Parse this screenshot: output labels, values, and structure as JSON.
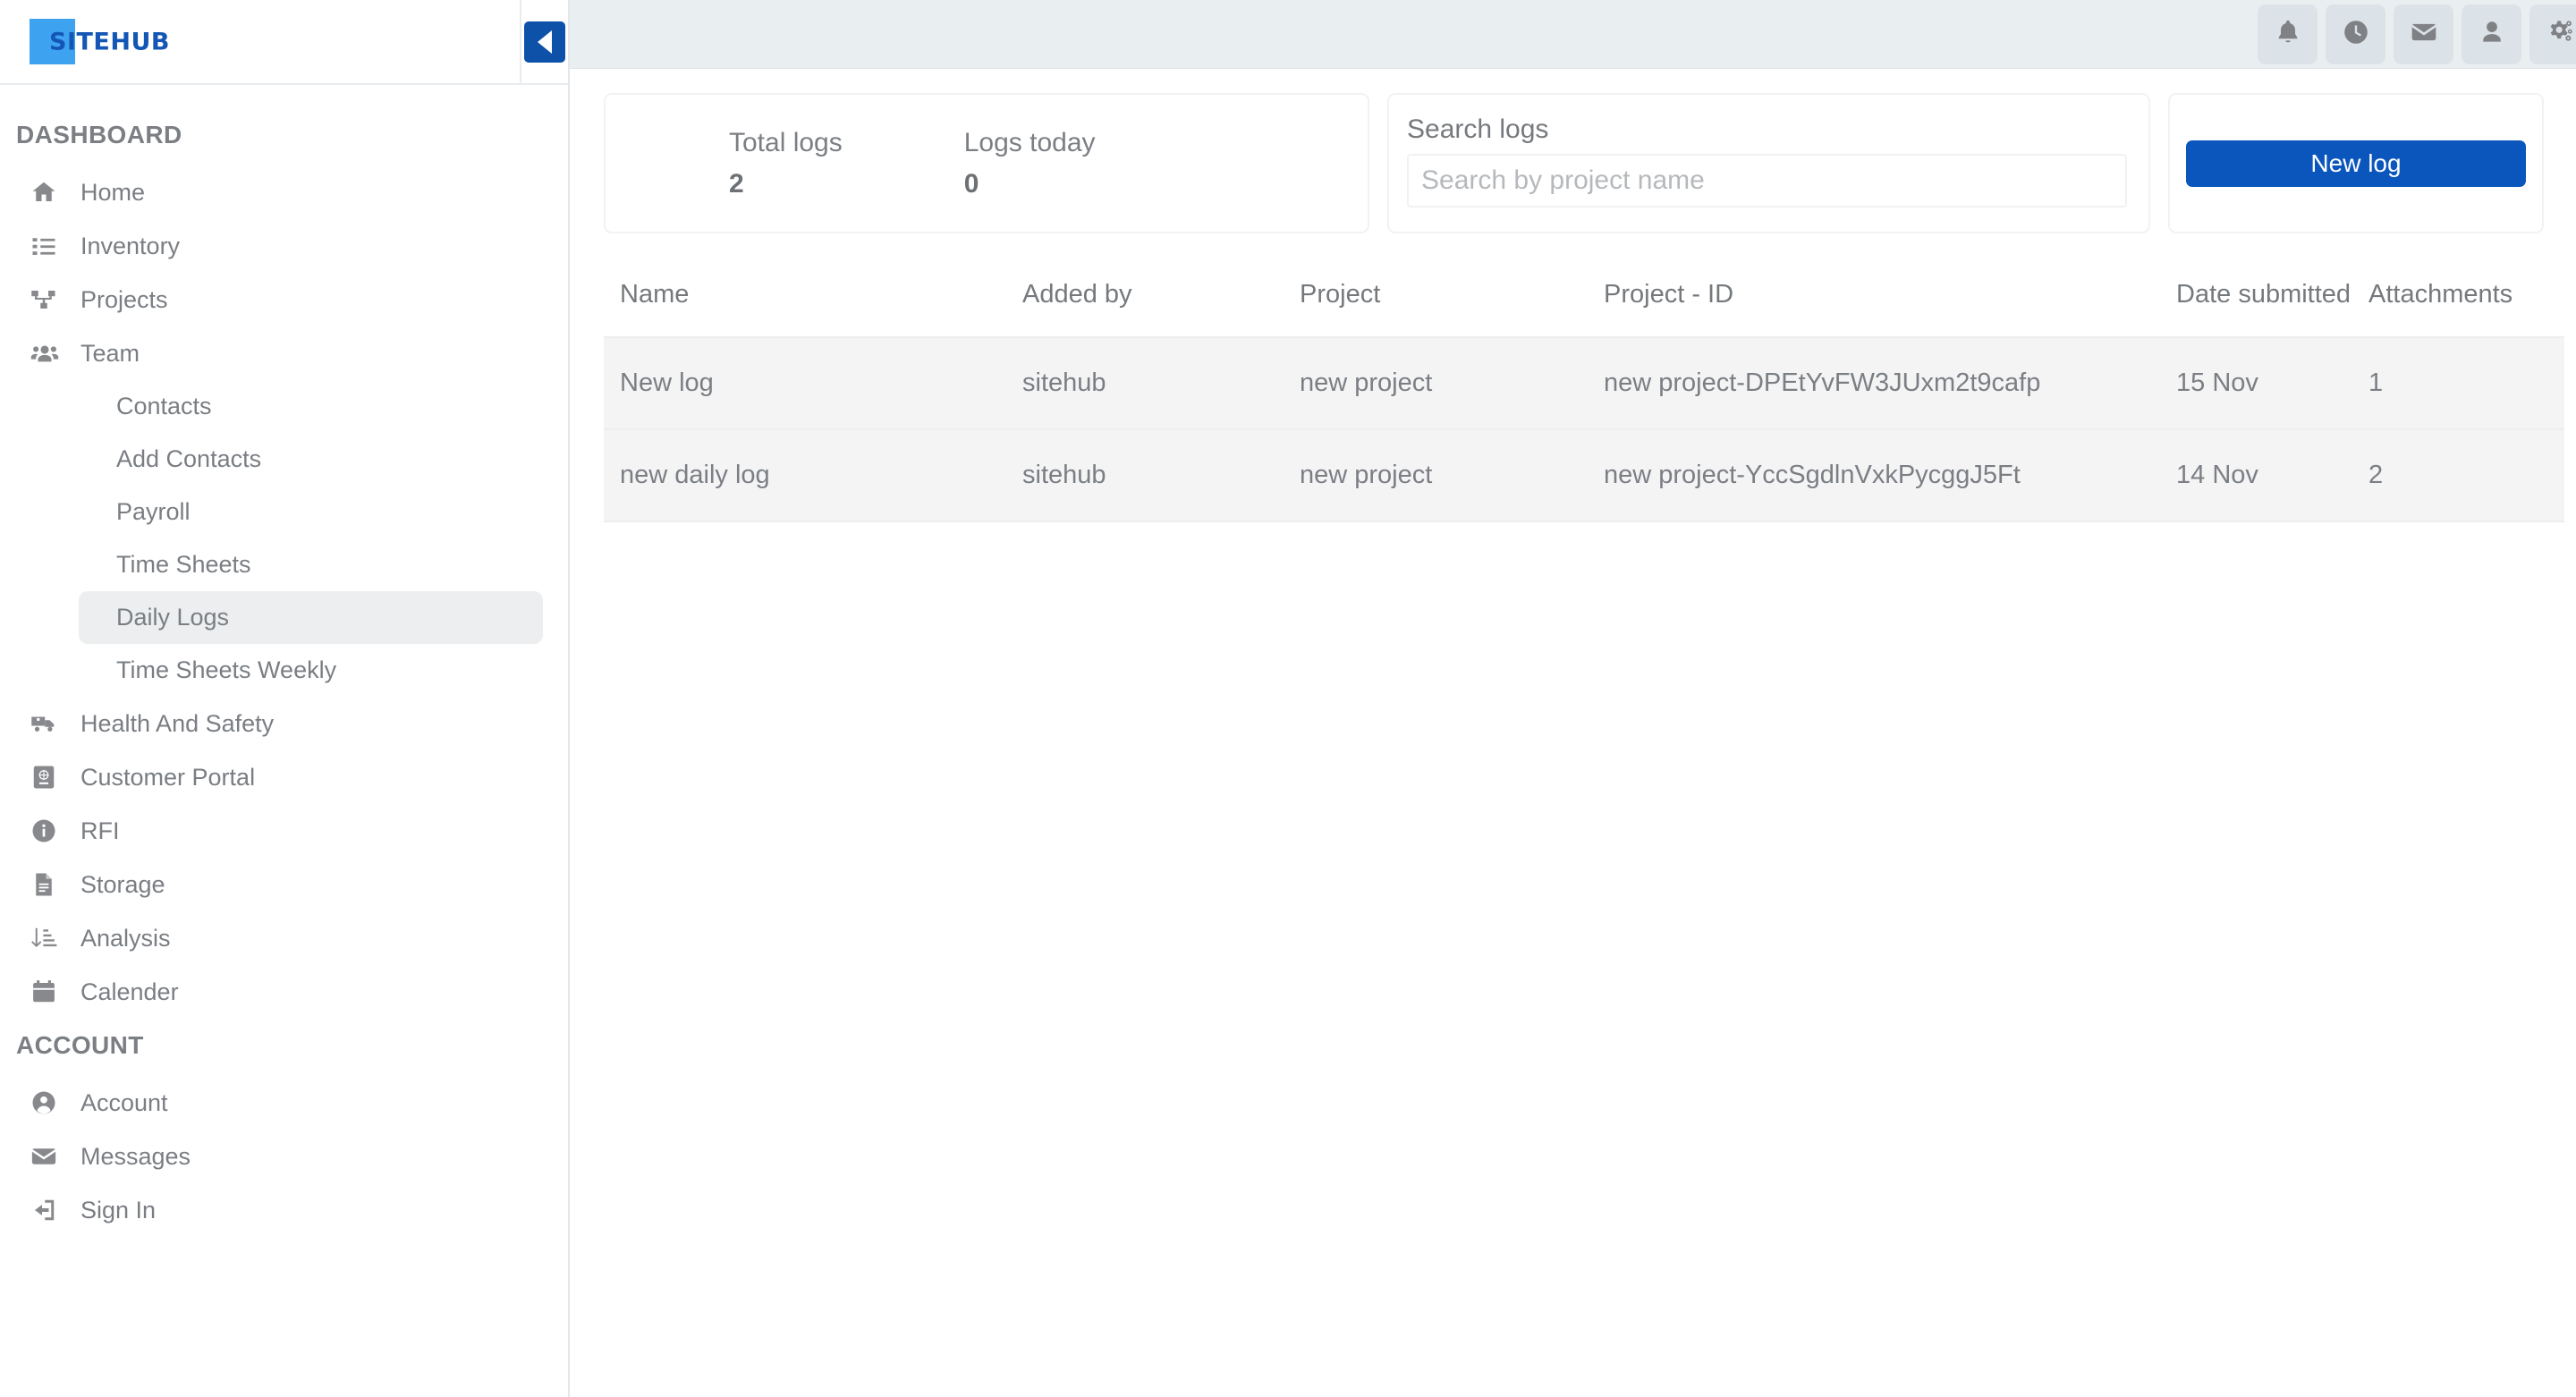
{
  "brand": {
    "logo_text": "SITEHUB"
  },
  "sidebar": {
    "collapse_icon": "chevron-left-icon",
    "sections": [
      {
        "title": "DASHBOARD",
        "items": [
          {
            "label": "Home",
            "icon": "home-icon"
          },
          {
            "label": "Inventory",
            "icon": "list-icon"
          },
          {
            "label": "Projects",
            "icon": "sitemap-icon"
          },
          {
            "label": "Team",
            "icon": "users-icon",
            "subitems": [
              {
                "label": "Contacts",
                "active": false
              },
              {
                "label": "Add Contacts",
                "active": false
              },
              {
                "label": "Payroll",
                "active": false
              },
              {
                "label": "Time Sheets",
                "active": false
              },
              {
                "label": "Daily Logs",
                "active": true
              },
              {
                "label": "Time Sheets Weekly",
                "active": false
              }
            ]
          },
          {
            "label": "Health And Safety",
            "icon": "ambulance-icon"
          },
          {
            "label": "Customer Portal",
            "icon": "passport-icon"
          },
          {
            "label": "RFI",
            "icon": "info-circle-icon"
          },
          {
            "label": "Storage",
            "icon": "file-document-icon"
          },
          {
            "label": "Analysis",
            "icon": "sort-amount-down-icon"
          },
          {
            "label": "Calender",
            "icon": "calendar-icon"
          }
        ]
      },
      {
        "title": "ACCOUNT",
        "items": [
          {
            "label": "Account",
            "icon": "user-circle-icon"
          },
          {
            "label": "Messages",
            "icon": "envelope-icon"
          },
          {
            "label": "Sign In",
            "icon": "sign-in-icon"
          }
        ]
      }
    ]
  },
  "topbar": {
    "icons": [
      {
        "name": "bell-icon"
      },
      {
        "name": "clock-icon"
      },
      {
        "name": "envelope-icon"
      },
      {
        "name": "user-icon"
      },
      {
        "name": "cogs-icon"
      }
    ]
  },
  "stats": [
    {
      "label": "Total logs",
      "value": "2"
    },
    {
      "label": "Logs today",
      "value": "0"
    }
  ],
  "search": {
    "label": "Search logs",
    "value": "",
    "placeholder": "Search by project name"
  },
  "actions": {
    "new_log_label": "New log",
    "accent_color": "#0b56bd"
  },
  "table": {
    "columns": [
      "Name",
      "Added by",
      "Project",
      "Project - ID",
      "Date submitted",
      "Attachments"
    ],
    "rows": [
      {
        "name": "New log",
        "added_by": "sitehub",
        "project": "new project",
        "project_id": "new project-DPEtYvFW3JUxm2t9cafp",
        "date_submitted": "15 Nov",
        "attachments": "1"
      },
      {
        "name": "new daily log",
        "added_by": "sitehub",
        "project": "new project",
        "project_id": "new project-YccSgdlnVxkPycggJ5Ft",
        "date_submitted": "14 Nov",
        "attachments": "2"
      }
    ]
  }
}
